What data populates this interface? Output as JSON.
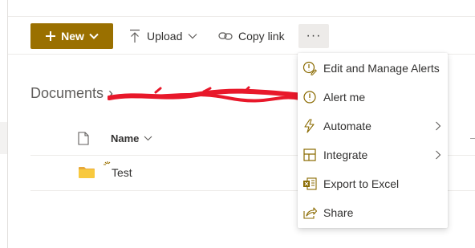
{
  "colors": {
    "accent": "#9a7000",
    "icon_gold": "#8a6a00",
    "folder": "#f8c93e",
    "redaction": "#e8182a"
  },
  "toolbar": {
    "new_label": "New",
    "upload_label": "Upload",
    "copy_link_label": "Copy link",
    "more_label": "···"
  },
  "breadcrumb": {
    "root": "Documents",
    "separator": "›"
  },
  "list": {
    "columns": [
      {
        "label": "Name",
        "icon": "file-icon"
      }
    ],
    "rows": [
      {
        "name": "Test",
        "type": "folder",
        "new_item": true
      }
    ]
  },
  "menu": {
    "items": [
      {
        "label": "Edit and Manage Alerts",
        "icon": "alert-edit-icon",
        "submenu": false
      },
      {
        "label": "Alert me",
        "icon": "alert-icon",
        "submenu": false
      },
      {
        "label": "Automate",
        "icon": "flow-icon",
        "submenu": true
      },
      {
        "label": "Integrate",
        "icon": "integrate-icon",
        "submenu": true
      },
      {
        "label": "Export to Excel",
        "icon": "excel-icon",
        "submenu": false
      },
      {
        "label": "Share",
        "icon": "share-icon",
        "submenu": false
      }
    ]
  }
}
